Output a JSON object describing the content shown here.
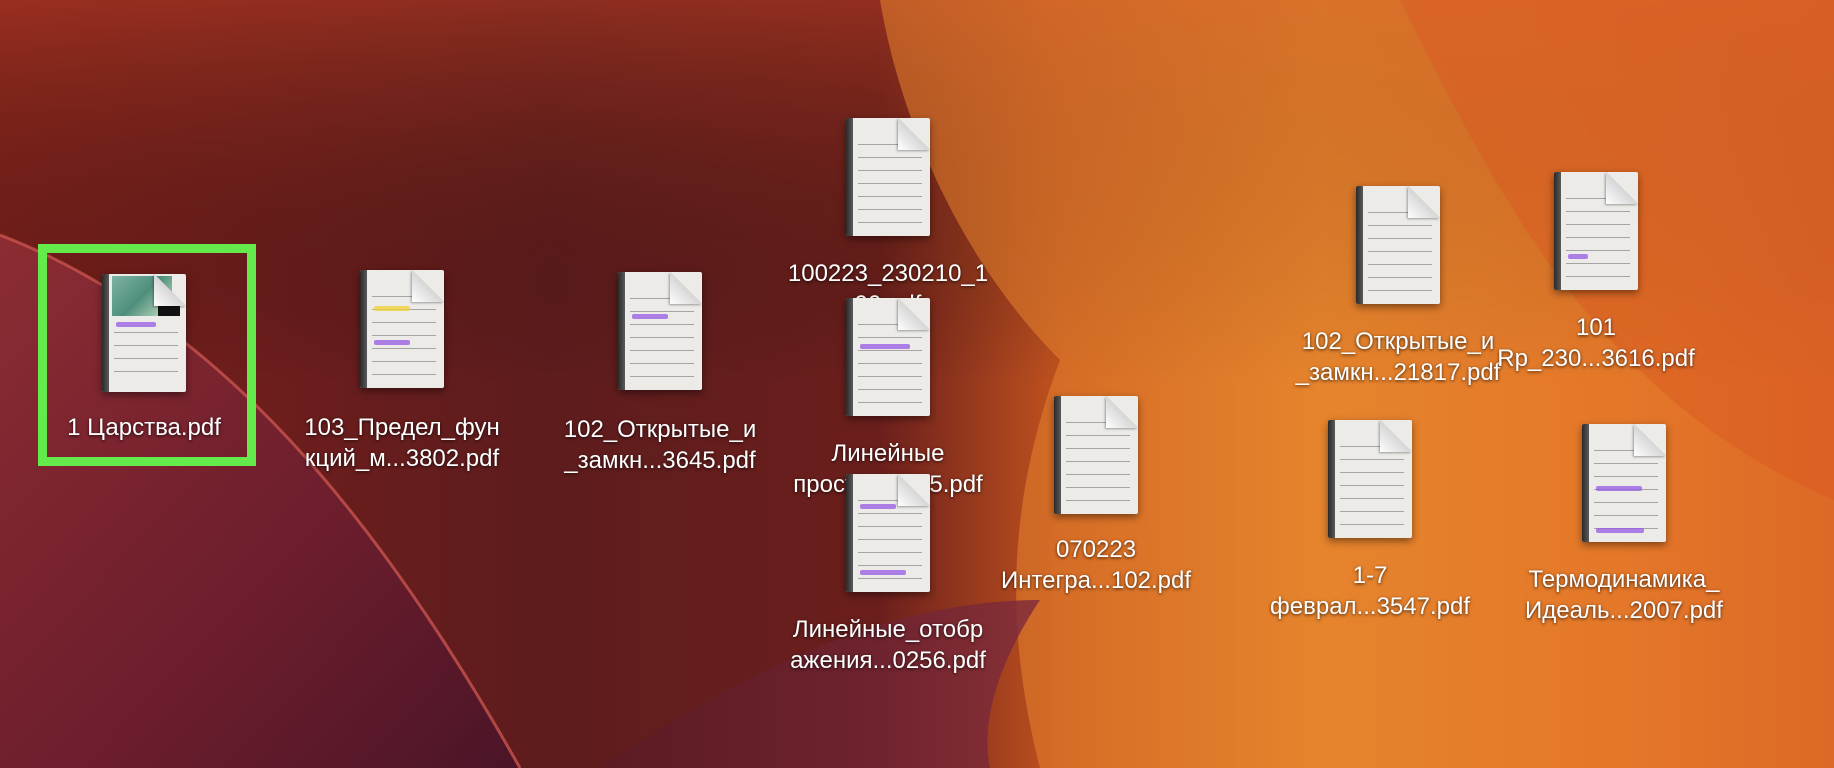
{
  "desktop": {
    "wallpaper": "macOS Ventura orange-red wallpaper",
    "colors": {
      "selection_highlight": "#65ea4b",
      "label_text": "#ffffff"
    },
    "files": [
      {
        "line1": "1 Царства.pdf",
        "line2": "",
        "selected": true,
        "thumbnail": "photo-page-thumbnail"
      },
      {
        "line1": "103_Предел_фун",
        "line2": "кций_м...3802.pdf",
        "selected": false,
        "thumbnail": "handwritten-notes-thumbnail"
      },
      {
        "line1": "102_Открытые_и",
        "line2": "_замкн...3645.pdf",
        "selected": false,
        "thumbnail": "handwritten-notes-thumbnail"
      },
      {
        "line1": "100223_230210_1",
        "line2": "90...df",
        "selected": false,
        "thumbnail": "handwritten-notes-thumbnail"
      },
      {
        "line1": "Линейные",
        "line2": "простра...745.pdf",
        "selected": false,
        "thumbnail": "handwritten-notes-thumbnail"
      },
      {
        "line1": "Линейные_отобр",
        "line2": "ажения...0256.pdf",
        "selected": false,
        "thumbnail": "handwritten-notes-thumbnail"
      },
      {
        "line1": "070223",
        "line2": "Интегра...102.pdf",
        "selected": false,
        "thumbnail": "handwritten-notes-thumbnail"
      },
      {
        "line1": "102_Открытые_и",
        "line2": "_замкн...21817.pdf",
        "selected": false,
        "thumbnail": "handwritten-notes-thumbnail"
      },
      {
        "line1": "101",
        "line2": "Rp_230...3616.pdf",
        "selected": false,
        "thumbnail": "handwritten-notes-thumbnail"
      },
      {
        "line1": "1-7",
        "line2": "феврал...3547.pdf",
        "selected": false,
        "thumbnail": "handwritten-notes-thumbnail"
      },
      {
        "line1": "Термодинамика_",
        "line2": "Идеаль...2007.pdf",
        "selected": false,
        "thumbnail": "handwritten-notes-thumbnail"
      }
    ]
  }
}
